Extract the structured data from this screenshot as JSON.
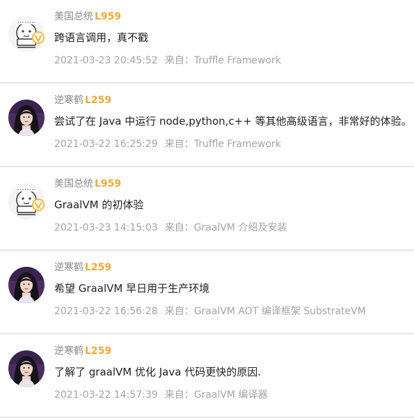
{
  "comments": [
    {
      "avatar": "typing-meme-cartoon",
      "username": "美国总统",
      "level": "L959",
      "content": "跨语言调用，真不戳",
      "timestamp": "2021-03-23 20:45:52",
      "from_label": "来自：",
      "source": "Truffle Framework",
      "vip": true
    },
    {
      "avatar": "woman-photo",
      "username": "逆寒鹤",
      "level": "L259",
      "content": "尝试了在 Java 中运行 node,python,c++ 等其他高级语言，非常好的体验。",
      "timestamp": "2021-03-22 16:25:29",
      "from_label": "来自：",
      "source": "Truffle Framework",
      "vip": false
    },
    {
      "avatar": "typing-meme-cartoon",
      "username": "美国总统",
      "level": "L959",
      "content": "GraalVM 的初体验",
      "timestamp": "2021-03-23 14:15:03",
      "from_label": "来自：",
      "source": "GraalVM 介绍及安装",
      "vip": true
    },
    {
      "avatar": "woman-photo",
      "username": "逆寒鹤",
      "level": "L259",
      "content": "希望 GraalVM 早日用于生产环境",
      "timestamp": "2021-03-22 16:56:28",
      "from_label": "来自：",
      "source": "GraalVM AOT 编译框架 SubstrateVM",
      "vip": false
    },
    {
      "avatar": "woman-photo",
      "username": "逆寒鹤",
      "level": "L259",
      "content": "了解了 graalVM 优化 Java 代码更快的原因.",
      "timestamp": "2021-03-22 14:57:39",
      "from_label": "来自：",
      "source": "GraalVM 编译器",
      "vip": false
    }
  ],
  "colors": {
    "level": "#f2a93b",
    "username": "#8a8a8a",
    "meta": "#a3a3a3",
    "divider": "#e6e6e6",
    "vip_badge": "#f5b942"
  }
}
